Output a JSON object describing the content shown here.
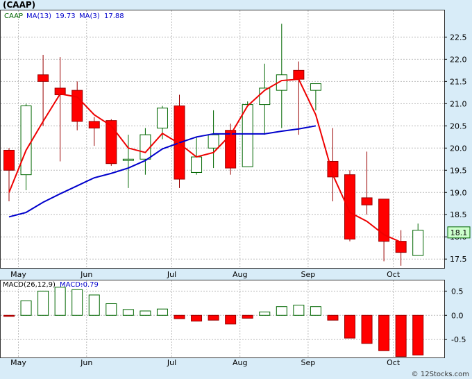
{
  "colors": {
    "band": "#d8ecf8",
    "up": "#ffffff",
    "up_stroke": "#006600",
    "down": "#ff0000",
    "down_stroke": "#990000",
    "ma13": "#0000cc",
    "ma3": "#ee0000",
    "last_price_box": "#ccffcc"
  },
  "chart_data": [
    {
      "type": "candlestick",
      "title": "(CAAP)",
      "legend": {
        "ticker": "CAAP",
        "ma13_label": "MA(13)",
        "ma13_value": "19.73",
        "ma3_label": "MA(3)",
        "ma3_value": "17.88"
      },
      "last_price_label": "18.1",
      "last_price": 18.1,
      "ylim": [
        17.3,
        23.1
      ],
      "yticks": [
        "17.5",
        "18.0",
        "18.5",
        "19.0",
        "19.5",
        "20.0",
        "20.5",
        "21.0",
        "21.5",
        "22.0",
        "22.5"
      ],
      "x_month_labels": [
        {
          "label": "May",
          "index": 1
        },
        {
          "label": "Jun",
          "index": 5
        },
        {
          "label": "Jul",
          "index": 10
        },
        {
          "label": "Aug",
          "index": 14
        },
        {
          "label": "Sep",
          "index": 18
        },
        {
          "label": "Oct",
          "index": 23
        }
      ],
      "grid": true,
      "candles": [
        {
          "o": 19.95,
          "h": 20.0,
          "l": 18.8,
          "c": 19.5
        },
        {
          "o": 19.4,
          "h": 21.0,
          "l": 19.05,
          "c": 20.95
        },
        {
          "o": 21.65,
          "h": 22.1,
          "l": 20.5,
          "c": 21.5
        },
        {
          "o": 21.35,
          "h": 22.05,
          "l": 19.7,
          "c": 21.2
        },
        {
          "o": 21.3,
          "h": 21.5,
          "l": 20.4,
          "c": 20.6
        },
        {
          "o": 20.6,
          "h": 20.7,
          "l": 20.05,
          "c": 20.45
        },
        {
          "o": 20.62,
          "h": 20.65,
          "l": 19.6,
          "c": 19.65
        },
        {
          "o": 19.72,
          "h": 20.3,
          "l": 19.1,
          "c": 19.75
        },
        {
          "o": 19.75,
          "h": 20.45,
          "l": 19.4,
          "c": 20.3
        },
        {
          "o": 20.45,
          "h": 20.95,
          "l": 20.2,
          "c": 20.9
        },
        {
          "o": 20.95,
          "h": 21.2,
          "l": 19.1,
          "c": 19.3
        },
        {
          "o": 19.45,
          "h": 20.25,
          "l": 19.4,
          "c": 19.8
        },
        {
          "o": 20.0,
          "h": 20.85,
          "l": 19.55,
          "c": 20.3
        },
        {
          "o": 20.4,
          "h": 20.55,
          "l": 19.4,
          "c": 19.55
        },
        {
          "o": 19.58,
          "h": 21.05,
          "l": 19.58,
          "c": 20.98
        },
        {
          "o": 20.98,
          "h": 21.9,
          "l": 20.3,
          "c": 21.35
        },
        {
          "o": 21.3,
          "h": 22.8,
          "l": 20.45,
          "c": 21.65
        },
        {
          "o": 21.75,
          "h": 21.95,
          "l": 20.3,
          "c": 21.55
        },
        {
          "o": 21.3,
          "h": 21.45,
          "l": 20.85,
          "c": 21.45
        },
        {
          "o": 19.7,
          "h": 20.45,
          "l": 18.8,
          "c": 19.35
        },
        {
          "o": 19.4,
          "h": 19.5,
          "l": 17.9,
          "c": 17.95
        },
        {
          "o": 18.88,
          "h": 19.92,
          "l": 18.5,
          "c": 18.72
        },
        {
          "o": 18.85,
          "h": 18.85,
          "l": 17.45,
          "c": 17.9
        },
        {
          "o": 17.9,
          "h": 18.15,
          "l": 17.35,
          "c": 17.65
        },
        {
          "o": 17.58,
          "h": 18.3,
          "l": 17.58,
          "c": 18.15
        }
      ],
      "ma13": [
        18.45,
        18.55,
        18.78,
        18.97,
        19.15,
        19.33,
        19.43,
        19.55,
        19.72,
        19.98,
        20.12,
        20.25,
        20.32,
        20.32,
        20.32,
        20.32,
        20.38,
        20.43,
        20.5
      ],
      "ma13_start_index": 0,
      "ma3": [
        19.0,
        19.95,
        20.6,
        21.22,
        21.15,
        20.75,
        20.5,
        20.0,
        19.9,
        20.33,
        20.1,
        19.8,
        19.9,
        20.3,
        20.95,
        21.3,
        21.52,
        21.55,
        20.75,
        19.4,
        18.55,
        18.35,
        18.05,
        17.88
      ],
      "ma3_start_index": 0
    },
    {
      "type": "bar",
      "title": "MACD(26,12,9)",
      "legend": {
        "label": "MACD(26,12,9)",
        "value_label": "MACD:",
        "value": "-0.79"
      },
      "ylim": [
        -0.87,
        0.72
      ],
      "yticks": [
        "0.5",
        "0.0",
        "-0.5"
      ],
      "grid": true,
      "values": [
        -0.02,
        0.3,
        0.5,
        0.58,
        0.53,
        0.42,
        0.24,
        0.12,
        0.09,
        0.13,
        -0.07,
        -0.12,
        -0.1,
        -0.18,
        -0.06,
        0.07,
        0.18,
        0.21,
        0.18,
        -0.1,
        -0.47,
        -0.58,
        -0.73,
        -0.85,
        -0.82
      ]
    }
  ],
  "credit": "© 12Stocks.com"
}
